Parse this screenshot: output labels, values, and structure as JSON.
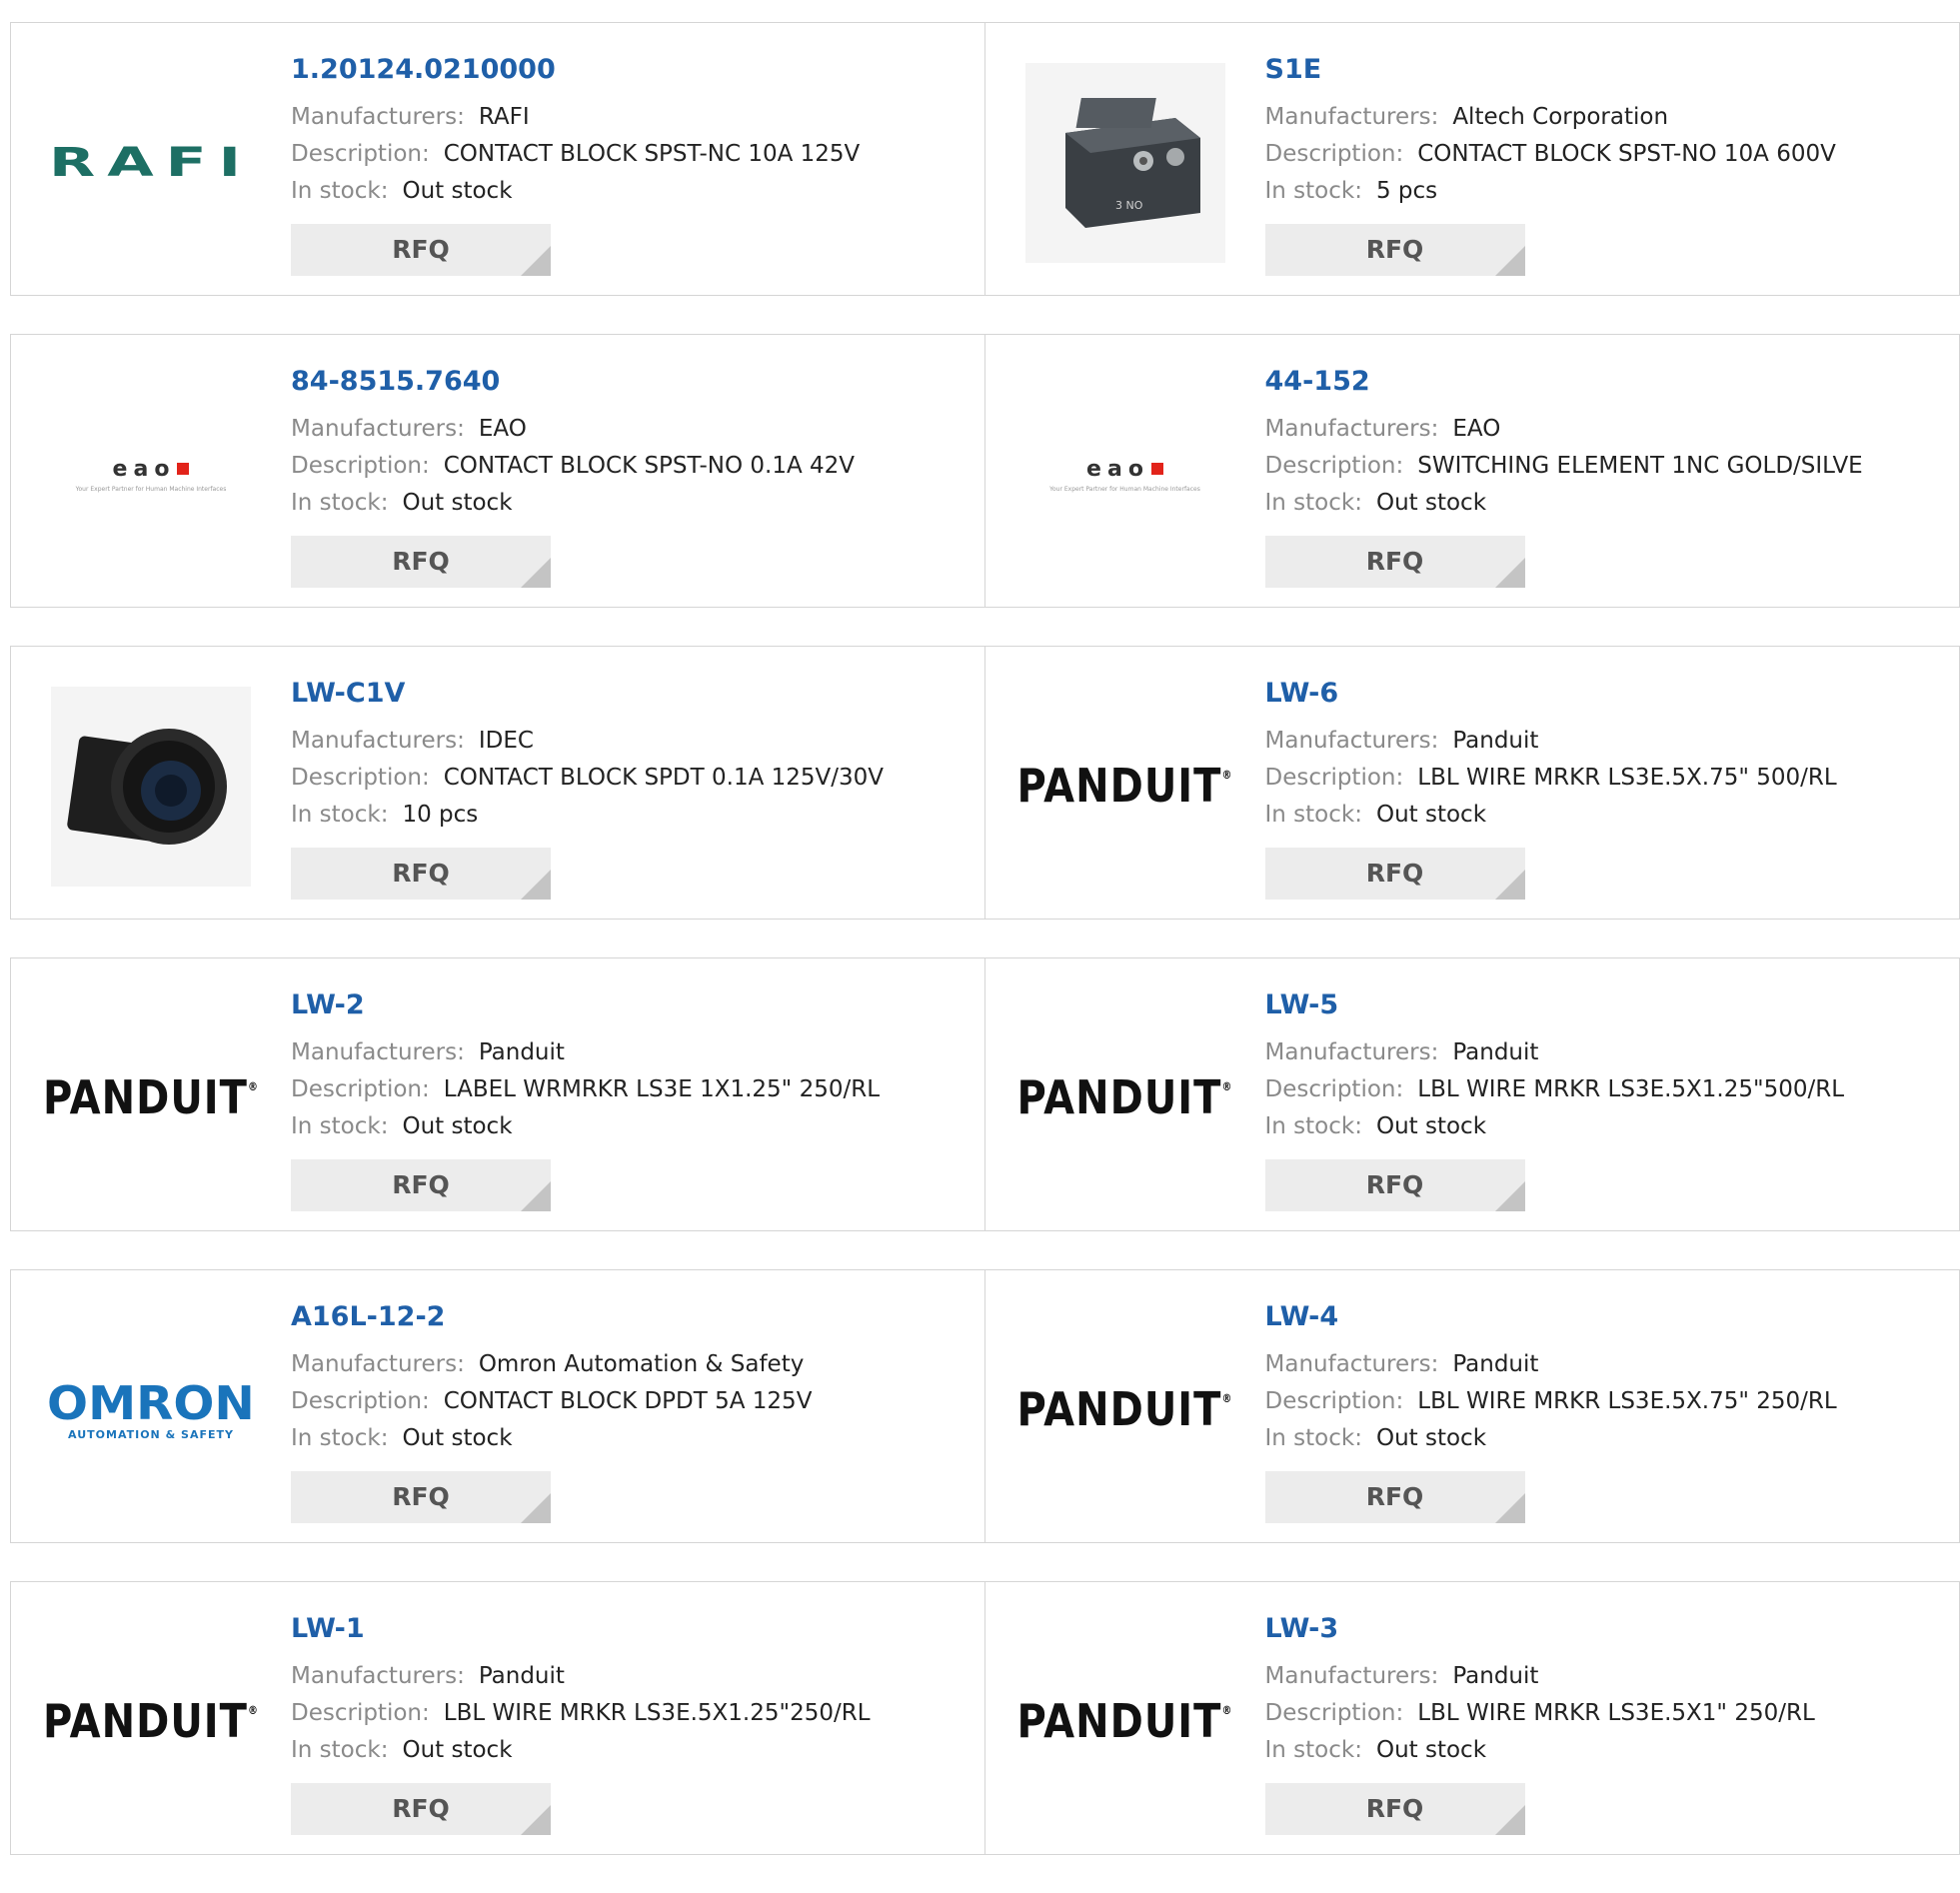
{
  "labels": {
    "manufacturers": "Manufacturers:",
    "description": "Description:",
    "in_stock": "In stock:",
    "rfq": "RFQ"
  },
  "logo_text": {
    "rafi": "RAFI",
    "eao": "eao",
    "eao_tagline": "Your Expert Partner for Human Machine Interfaces",
    "panduit": "PANDUIT",
    "omron": "OMRON",
    "omron_tagline": "AUTOMATION & SAFETY",
    "s1e_label": "3 NO"
  },
  "products": [
    {
      "part": "1.20124.0210000",
      "manufacturer": "RAFI",
      "description": "CONTACT BLOCK SPST-NC 10A 125V",
      "stock": "Out stock",
      "logo": "rafi-logo"
    },
    {
      "part": "S1E",
      "manufacturer": "Altech Corporation",
      "description": "CONTACT BLOCK SPST-NO 10A 600V",
      "stock": "5 pcs",
      "logo": "contact-block-photo"
    },
    {
      "part": "84-8515.7640",
      "manufacturer": "EAO",
      "description": "CONTACT BLOCK SPST-NO 0.1A 42V",
      "stock": "Out stock",
      "logo": "eao-logo"
    },
    {
      "part": "44-152",
      "manufacturer": "EAO",
      "description": "SWITCHING ELEMENT 1NC GOLD/SILVE",
      "stock": "Out stock",
      "logo": "eao-logo"
    },
    {
      "part": "LW-C1V",
      "manufacturer": "IDEC",
      "description": "CONTACT BLOCK SPDT 0.1A 125V/30V",
      "stock": "10 pcs",
      "logo": "idec-photo"
    },
    {
      "part": "LW-6",
      "manufacturer": "Panduit",
      "description": "LBL WIRE MRKR LS3E.5X.75\" 500/RL",
      "stock": "Out stock",
      "logo": "panduit-logo"
    },
    {
      "part": "LW-2",
      "manufacturer": "Panduit",
      "description": "LABEL WRMRKR LS3E 1X1.25\" 250/RL",
      "stock": "Out stock",
      "logo": "panduit-logo"
    },
    {
      "part": "LW-5",
      "manufacturer": "Panduit",
      "description": "LBL WIRE MRKR LS3E.5X1.25\"500/RL",
      "stock": "Out stock",
      "logo": "panduit-logo"
    },
    {
      "part": "A16L-12-2",
      "manufacturer": "Omron Automation & Safety",
      "description": "CONTACT BLOCK DPDT 5A 125V",
      "stock": "Out stock",
      "logo": "omron-logo"
    },
    {
      "part": "LW-4",
      "manufacturer": "Panduit",
      "description": "LBL WIRE MRKR LS3E.5X.75\" 250/RL",
      "stock": "Out stock",
      "logo": "panduit-logo"
    },
    {
      "part": "LW-1",
      "manufacturer": "Panduit",
      "description": "LBL WIRE MRKR LS3E.5X1.25\"250/RL",
      "stock": "Out stock",
      "logo": "panduit-logo"
    },
    {
      "part": "LW-3",
      "manufacturer": "Panduit",
      "description": "LBL WIRE MRKR LS3E.5X1\" 250/RL",
      "stock": "Out stock",
      "logo": "panduit-logo"
    }
  ],
  "colors": {
    "part_link": "#1f5fa8",
    "label": "#8a8a8a",
    "value": "#222222",
    "border": "#d5d5d5",
    "rfq_bg": "#ececec"
  }
}
